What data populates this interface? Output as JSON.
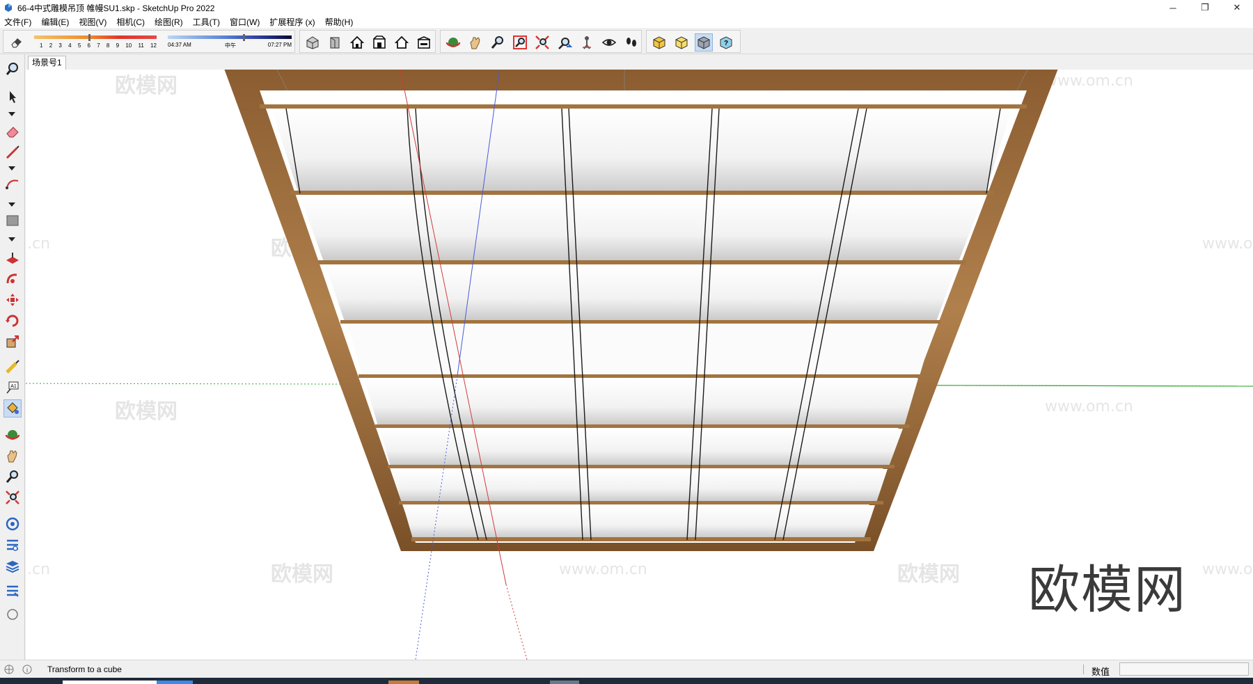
{
  "window": {
    "title": "66-4中式雕模吊顶 帷幔SU1.skp - SketchUp Pro 2022",
    "controls": {
      "minimize": "─",
      "restore": "❐",
      "close": "✕"
    }
  },
  "menu": [
    "文件(F)",
    "编辑(E)",
    "视图(V)",
    "相机(C)",
    "绘图(R)",
    "工具(T)",
    "窗口(W)",
    "扩展程序 (x)",
    "帮助(H)"
  ],
  "shadow_settings": {
    "months": [
      "1",
      "2",
      "3",
      "4",
      "5",
      "6",
      "7",
      "8",
      "9",
      "10",
      "11",
      "12"
    ],
    "time_start": "04:37 AM",
    "time_mid": "中午",
    "time_end": "07:27 PM"
  },
  "toolbar_icons": [
    "eraser-icon",
    "iso-view-icon",
    "top-view-icon",
    "front-view-icon",
    "right-view-icon",
    "back-view-icon",
    "left-view-icon",
    "orbit-icon",
    "pan-icon",
    "zoom-icon",
    "zoom-window-icon",
    "zoom-extents-icon",
    "previous-view-icon",
    "position-camera-icon",
    "look-around-icon",
    "walk-icon",
    "xray-style-icon",
    "back-edges-style-icon",
    "wireframe-style-icon",
    "help-cube-icon"
  ],
  "scene": {
    "tab_label": "场景号1"
  },
  "watermarks": {
    "brand": "欧模网",
    "url": "www.om.cn",
    "url_partial": ".cn",
    "big": "欧模网"
  },
  "status": {
    "hint": "Transform to a cube",
    "measurement_label": "数值",
    "measurement_value": ""
  },
  "colors": {
    "wood": "#9a6a3a",
    "axis_red": "#d23a3a",
    "axis_green": "#28a428",
    "axis_blue": "#4a5adb"
  }
}
